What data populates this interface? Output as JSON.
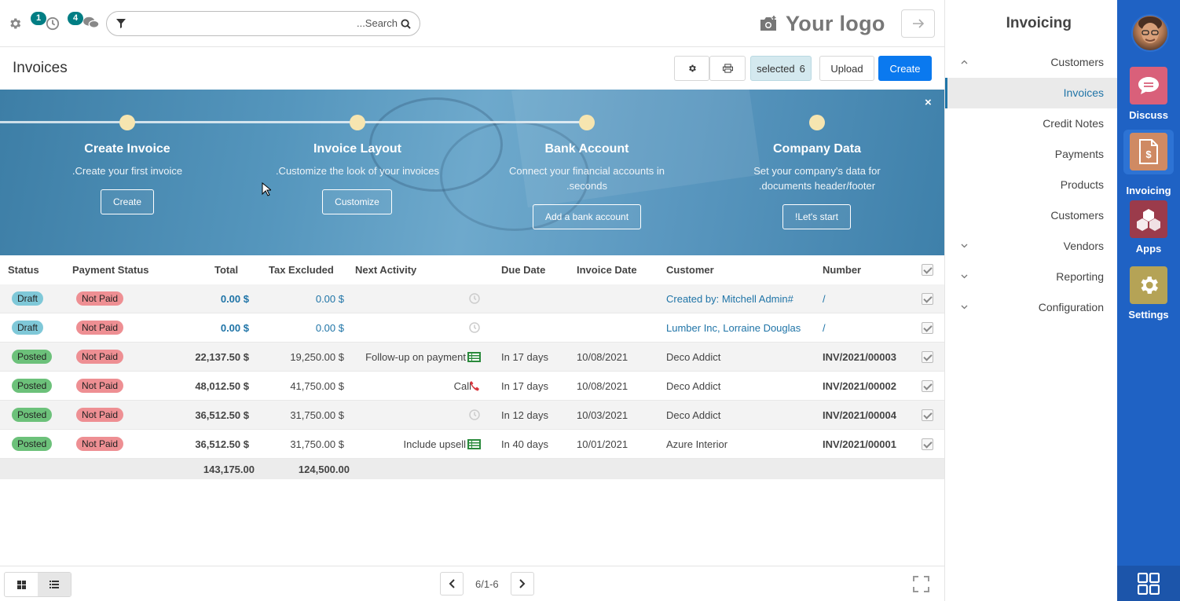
{
  "topbar": {
    "activity_count": "1",
    "message_count": "4",
    "search_placeholder": "...Search",
    "logo_text": "Your logo"
  },
  "control": {
    "page_title": "Invoices",
    "selected_label": "selected",
    "selected_count": "6",
    "upload_label": "Upload",
    "create_label": "Create"
  },
  "banner": {
    "steps": [
      {
        "title": "Create Invoice",
        "desc1": ".Create your first invoice",
        "desc2": "",
        "button": "Create"
      },
      {
        "title": "Invoice Layout",
        "desc1": ".Customize the look of your invoices",
        "desc2": "",
        "button": "Customize"
      },
      {
        "title": "Bank Account",
        "desc1": "Connect your financial accounts in",
        "desc2": ".seconds",
        "button": "Add a bank account"
      },
      {
        "title": "Company Data",
        "desc1": "Set your company's data for",
        "desc2": ".documents header/footer",
        "button": "!Let's start"
      }
    ],
    "close": "×"
  },
  "table": {
    "headers": {
      "status": "Status",
      "payment_status": "Payment Status",
      "total": "Total",
      "tax_excluded": "Tax Excluded",
      "next_activity": "Next Activity",
      "due_date": "Due Date",
      "invoice_date": "Invoice Date",
      "customer": "Customer",
      "number": "Number"
    },
    "rows": [
      {
        "status": "Draft",
        "payment": "Not Paid",
        "total": "0.00 $",
        "tax": "0.00 $",
        "activity": "",
        "activity_icon": "clock-icon",
        "due": "",
        "date": "",
        "customer": "Created by: Mitchell Admin#",
        "number": "/"
      },
      {
        "status": "Draft",
        "payment": "Not Paid",
        "total": "0.00 $",
        "tax": "0.00 $",
        "activity": "",
        "activity_icon": "clock-icon",
        "due": "",
        "date": "",
        "customer": "Lumber Inc, Lorraine Douglas",
        "number": "/"
      },
      {
        "status": "Posted",
        "payment": "Not Paid",
        "total": "22,137.50 $",
        "tax": "19,250.00 $",
        "activity": "Follow-up on payment",
        "activity_icon": "list-icon",
        "due": "In 17 days",
        "date": "10/08/2021",
        "customer": "Deco Addict",
        "number": "INV/2021/00003"
      },
      {
        "status": "Posted",
        "payment": "Not Paid",
        "total": "48,012.50 $",
        "tax": "41,750.00 $",
        "activity": "Call",
        "activity_icon": "phone-icon",
        "due": "In 17 days",
        "date": "10/08/2021",
        "customer": "Deco Addict",
        "number": "INV/2021/00002"
      },
      {
        "status": "Posted",
        "payment": "Not Paid",
        "total": "36,512.50 $",
        "tax": "31,750.00 $",
        "activity": "",
        "activity_icon": "clock-icon",
        "due": "In 12 days",
        "date": "10/03/2021",
        "customer": "Deco Addict",
        "number": "INV/2021/00004"
      },
      {
        "status": "Posted",
        "payment": "Not Paid",
        "total": "36,512.50 $",
        "tax": "31,750.00 $",
        "activity": "Include upsell",
        "activity_icon": "list-icon",
        "due": "In 40 days",
        "date": "10/01/2021",
        "customer": "Azure Interior",
        "number": "INV/2021/00001"
      }
    ],
    "totals": {
      "total": "143,175.00",
      "tax": "124,500.00"
    }
  },
  "footer": {
    "pager": "6/1-6"
  },
  "sidenav": {
    "title": "Invoicing",
    "items": [
      {
        "label": "Customers",
        "chevron": "up"
      },
      {
        "label": "Invoices",
        "chevron": ""
      },
      {
        "label": "Credit Notes",
        "chevron": ""
      },
      {
        "label": "Payments",
        "chevron": ""
      },
      {
        "label": "Products",
        "chevron": ""
      },
      {
        "label": "Customers",
        "chevron": ""
      },
      {
        "label": "Vendors",
        "chevron": "down"
      },
      {
        "label": "Reporting",
        "chevron": "down"
      },
      {
        "label": "Configuration",
        "chevron": "down"
      }
    ]
  },
  "apps": [
    {
      "name": "Discuss",
      "icon": "chat-bubble-icon",
      "color": "#d9607a"
    },
    {
      "name": "Invoicing",
      "icon": "invoice-dollar-icon",
      "color": "#cf8a63"
    },
    {
      "name": "Apps",
      "icon": "cubes-icon",
      "color": "#9b3b4b"
    },
    {
      "name": "Settings",
      "icon": "gear-icon",
      "color": "#b5a356"
    }
  ],
  "colors": {
    "primary": "#0a79ef",
    "appbar": "#1f62c4",
    "link": "#1f74a7",
    "draft": "#7fc8d8",
    "posted": "#6cc17a",
    "not_paid": "#ee8f93"
  }
}
